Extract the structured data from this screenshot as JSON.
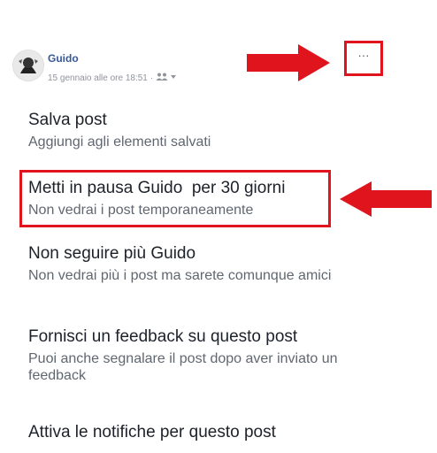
{
  "post": {
    "author": "Guido",
    "timestamp": "15 gennaio alle ore 18:51",
    "audience_icons": "ᴂ▾"
  },
  "more_button": {
    "label": "···"
  },
  "menu": [
    {
      "title": "Salva post",
      "subtitle": "Aggiungi agli elementi salvati"
    },
    {
      "title": "Metti in pausa Guido  per 30 giorni",
      "subtitle": "Non vedrai i post temporaneamente"
    },
    {
      "title": "Non seguire più Guido",
      "subtitle": "Non vedrai più i post ma sarete comunque amici"
    },
    {
      "title": "Fornisci un feedback su questo post",
      "subtitle": "Puoi anche segnalare il post dopo aver inviato un feedback"
    },
    {
      "title": "Attiva le notifiche per questo post"
    }
  ],
  "colors": {
    "annotation_red": "#e0141c",
    "author_blue": "#365899"
  },
  "icons": [
    "avatar",
    "people-icon",
    "caret-down-icon",
    "more-options-icon",
    "red-arrow-right",
    "red-arrow-left"
  ]
}
